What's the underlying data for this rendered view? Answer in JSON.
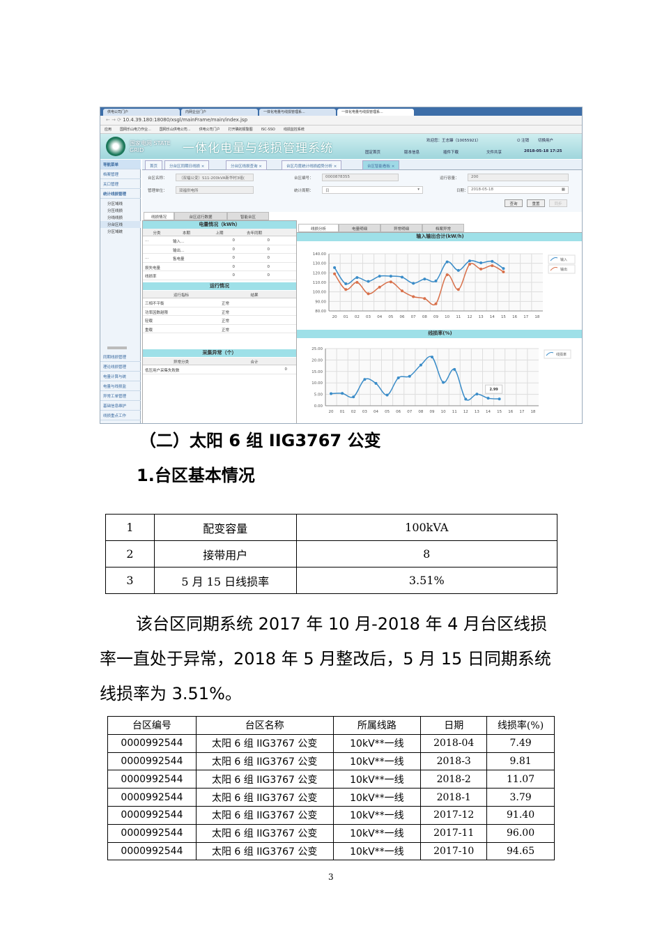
{
  "screenshot": {
    "browser_tabs": [
      "供电公司门户",
      "内网企业门户",
      "一体化电量与线损管理系...",
      "一体化电量与线损管理系..."
    ],
    "url": "10.4.39.180:18080/xsgl/mainFrame/main/index.jsp",
    "bookmarks": [
      "应用",
      "国网乐山电力作业...",
      "国网乐山供电公司...",
      "供电公司门户",
      "打开确初报警图",
      "ISC-SSO",
      "线损监控系统"
    ],
    "logo_text": "国家电网 STATE GRID",
    "system_title": "一体化电量与线损管理系统",
    "welcome": "欢迎您：王志臻（10055921）",
    "header_links": [
      "注销",
      "切换用户",
      "固定首页",
      "版本信息",
      "插件下载",
      "文件共享"
    ],
    "datetime": "2018-05-18 17:25",
    "nav_title": "导航菜单",
    "sidebar_top": [
      "档案管理",
      "关口管理",
      "统计线损管理"
    ],
    "sidebar_tree": [
      "分区域线",
      "分压线损",
      "分线线损",
      "分台区线",
      "分区域统"
    ],
    "sidebar_bottom": [
      "同期线损管理",
      "理论线损管理",
      "电量计算与统",
      "电量与线损监",
      "异常工单管理",
      "基础信息维护",
      "线损重点工作"
    ],
    "nav_tabs": [
      "首页",
      "分台区同期日线损",
      "分台区线损查询",
      "台区月度统计线损趋势分析",
      "台区智能看板"
    ],
    "form": {
      "name_label": "台区名称：",
      "name_value": "（双福公变）S11-200kVA新华村3组(",
      "code_label": "台区编号：",
      "code_value": "0000878355",
      "capacity_label": "运行容量：",
      "capacity_value": "200",
      "unit_label": "管理单位：",
      "unit_value": "双福供电所",
      "period_label": "统计周期：",
      "period_value": "日",
      "date_label": "日期：",
      "date_value": "2018-05-18",
      "buttons": [
        "查询",
        "重置",
        "同步"
      ]
    },
    "left_tabs": [
      "线损情况",
      "台区运行数据",
      "智能台区"
    ],
    "energy": {
      "title": "电量情况（kWh）",
      "headers": [
        "分类",
        "本期",
        "上期",
        "去年同期"
      ],
      "rows": [
        [
          "…",
          "输入...",
          "0",
          "0"
        ],
        [
          "",
          "输出...",
          "0",
          "0"
        ],
        [
          "…",
          "售电量",
          "0",
          "0"
        ],
        [
          "损失电量",
          "",
          "0",
          "0"
        ],
        [
          "线损率",
          "",
          "0",
          "0"
        ]
      ]
    },
    "operation": {
      "title": "运行情况",
      "headers": [
        "运行指标",
        "结果"
      ],
      "rows": [
        [
          "三相不平衡",
          "正常"
        ],
        [
          "功率因数越限",
          "正常"
        ],
        [
          "轻载",
          "正常"
        ],
        [
          "重载",
          "正常"
        ]
      ]
    },
    "collect": {
      "title": "采集异常（个）",
      "headers": [
        "异常分类",
        "合计"
      ],
      "rows": [
        [
          "低压用户采集失败数",
          "0"
        ]
      ]
    },
    "right_tabs": [
      "线损分析",
      "电量明细",
      "异常明细",
      "档案异常"
    ]
  },
  "chart_data": [
    {
      "type": "line",
      "title": "输入输出合计(kW/h)",
      "categories": [
        "20",
        "01",
        "02",
        "03",
        "04",
        "05",
        "06",
        "07",
        "08",
        "09",
        "10",
        "11",
        "12",
        "13",
        "14",
        "15",
        "16",
        "17",
        "18"
      ],
      "ylim": [
        80,
        140
      ],
      "yticks": [
        "80.00",
        "90.00",
        "100.00",
        "110.00",
        "120.00",
        "130.00",
        "140.00"
      ],
      "series": [
        {
          "name": "输入",
          "color": "#3a8cc8",
          "values": [
            125.5,
            108.5,
            115,
            111,
            116.5,
            116.5,
            115.5,
            109,
            113.5,
            111.5,
            131.5,
            122.5,
            132.5,
            130.5,
            132,
            124.5
          ]
        },
        {
          "name": "输出",
          "color": "#d8704a",
          "values": [
            119,
            102.5,
            110,
            98,
            105,
            110.5,
            101,
            95,
            93,
            87.5,
            118,
            102.5,
            129,
            124,
            127.5,
            121
          ]
        }
      ],
      "legend": "right"
    },
    {
      "type": "line",
      "title": "线损率(%)",
      "categories": [
        "20",
        "01",
        "02",
        "03",
        "04",
        "05",
        "06",
        "07",
        "08",
        "09",
        "10",
        "11",
        "12",
        "13",
        "14",
        "15",
        "16",
        "17",
        "18"
      ],
      "ylim": [
        0,
        25
      ],
      "yticks": [
        "0.00",
        "5.00",
        "10.00",
        "15.00",
        "20.00",
        "25.00"
      ],
      "series": [
        {
          "name": "线损率",
          "color": "#3a8cc8",
          "values": [
            5.3,
            5.4,
            3.9,
            11.5,
            9.8,
            4.7,
            12.2,
            12.9,
            17.8,
            21.3,
            10.2,
            15.9,
            2.9,
            5.1,
            3.3,
            2.99
          ]
        }
      ],
      "tooltip": "2.99",
      "legend": "right"
    }
  ],
  "heading": "（二）太阳 6 组 IIG3767 公变",
  "subheading": "1.台区基本情况",
  "basic_table": [
    [
      "1",
      "配变容量",
      "100kVA"
    ],
    [
      "2",
      "接带用户",
      "8"
    ],
    [
      "3",
      "5 月 15 日线损率",
      "3.51%"
    ]
  ],
  "paragraph_lines": [
    "该台区同期系统 2017 年 10 月-2018 年 4 月台区线损",
    "率一直处于异常，2018 年 5 月整改后，5 月 15 日同期系统",
    "线损率为 3.51%。"
  ],
  "loss_table": {
    "headers": [
      "台区编号",
      "台区名称",
      "所属线路",
      "日期",
      "线损率(%)"
    ],
    "rows": [
      [
        "0000992544",
        "太阳 6 组 IIG3767 公变",
        "10kV**一线",
        "2018-04",
        "7.49"
      ],
      [
        "0000992544",
        "太阳 6 组 IIG3767 公变",
        "10kV**一线",
        "2018-3",
        "9.81"
      ],
      [
        "0000992544",
        "太阳 6 组 IIG3767 公变",
        "10kV**一线",
        "2018-2",
        "11.07"
      ],
      [
        "0000992544",
        "太阳 6 组 IIG3767 公变",
        "10kV**一线",
        "2018-1",
        "3.79"
      ],
      [
        "0000992544",
        "太阳 6 组 IIG3767 公变",
        "10kV**一线",
        "2017-12",
        "91.40"
      ],
      [
        "0000992544",
        "太阳 6 组 IIG3767 公变",
        "10kV**一线",
        "2017-11",
        "96.00"
      ],
      [
        "0000992544",
        "太阳 6 组 IIG3767 公变",
        "10kV**一线",
        "2017-10",
        "94.65"
      ]
    ]
  },
  "page_number": "3"
}
